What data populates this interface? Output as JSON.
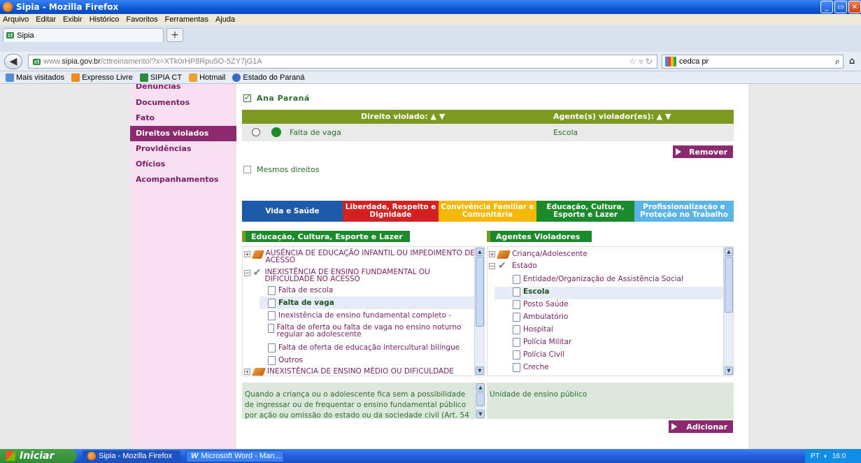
{
  "window": {
    "title": "Sipia - Mozilla Firefox",
    "controls": [
      "_",
      "▭",
      "✕"
    ]
  },
  "menu": [
    "Arquivo",
    "Editar",
    "Exibir",
    "Histórico",
    "Favoritos",
    "Ferramentas",
    "Ajuda"
  ],
  "tab": {
    "badge": "ct",
    "label": "Sipia",
    "new_tab": "+"
  },
  "url": {
    "prefix": "www.",
    "host": "sipia.gov.br",
    "path": "/cttreinamento/?x=XTk0rHP8Rpu5O-5ZY7jG1A",
    "search_value": "cedca pr"
  },
  "bookmarks": [
    "Mais visitados",
    "Expresso Livre",
    "SIPIA CT",
    "Hotmail",
    "Estado do Paraná"
  ],
  "sidebar": {
    "items": [
      {
        "label": "Denúncias"
      },
      {
        "label": "Documentos"
      },
      {
        "label": "Fato"
      },
      {
        "label": "Direitos violados",
        "active": true
      },
      {
        "label": "Providências"
      },
      {
        "label": "Ofícios"
      },
      {
        "label": "Acompanhamentos"
      }
    ]
  },
  "main": {
    "person_name": "Ana Paraná",
    "table": {
      "col_right": "Direito violado: ▲ ▼",
      "col_agent": "Agente(s) violador(es): ▲ ▼",
      "rows": [
        {
          "right": "Falta de vaga",
          "agent": "Escola"
        }
      ]
    },
    "remove_label": "Remover",
    "same_rights_label": "Mesmos direitos",
    "categories": [
      {
        "line1": "Vida e Saúde",
        "line2": "",
        "color": "#1d5aa8"
      },
      {
        "line1": "Liberdade, Respeito e",
        "line2": "Dignidade",
        "color": "#d42020"
      },
      {
        "line1": "Convivência Familiar e",
        "line2": "Comunitária",
        "color": "#f5b800"
      },
      {
        "line1": "Educação, Cultura,",
        "line2": "Esporte e Lazer",
        "color": "#1a8a2a"
      },
      {
        "line1": "Profissionalização e",
        "line2": "Proteção no Trabalho",
        "color": "#5ab4e6"
      }
    ],
    "left_section_title": "Educação, Cultura, Esporte e Lazer",
    "right_section_title": "Agentes Violadores",
    "left_tree": {
      "n1": "AUSÊNCIA DE EDUCAÇÃO INFANTIL OU IMPEDIMENTO DE ACESSO",
      "n2": "INEXISTÊNCIA DE ENSINO FUNDAMENTAL OU DIFICULDADE NO ACESSO",
      "leaves": [
        "Falta de escola",
        "Falta de vaga",
        "Inexistência de ensino fundamental completo -",
        "Falta de oferta ou falta de vaga no ensino noturno regular ao adolescente",
        "Falta de oferta de educação intercultural bilíngue",
        "Outros"
      ],
      "n3": "INEXISTÊNCIA DE ENSINO MÉDIO OU DIFICULDADE"
    },
    "right_tree": {
      "n1": "Criança/Adolescente",
      "n2": "Estado",
      "leaves": [
        "Entidade/Organização de Assistência Social",
        "Escola",
        "Posto Saúde",
        "Ambulatório",
        "Hospital",
        "Polícia Militar",
        "Polícia Civil",
        "Creche"
      ]
    },
    "left_description": "Quando a criança ou o adolescente fica sem a possibilidade de ingressar ou de frequentar o ensino fundamental público por ação ou omissão do estado ou da sociedade civil (Art. 54",
    "right_description": "Unidade de ensino público",
    "add_label": "Adicionar"
  },
  "taskbar": {
    "start": "Iniciar",
    "tasks": [
      "Sipia - Mozilla Firefox",
      "Microsoft Word - Man..."
    ],
    "tray_lang": "PT",
    "clock": "16:0"
  }
}
